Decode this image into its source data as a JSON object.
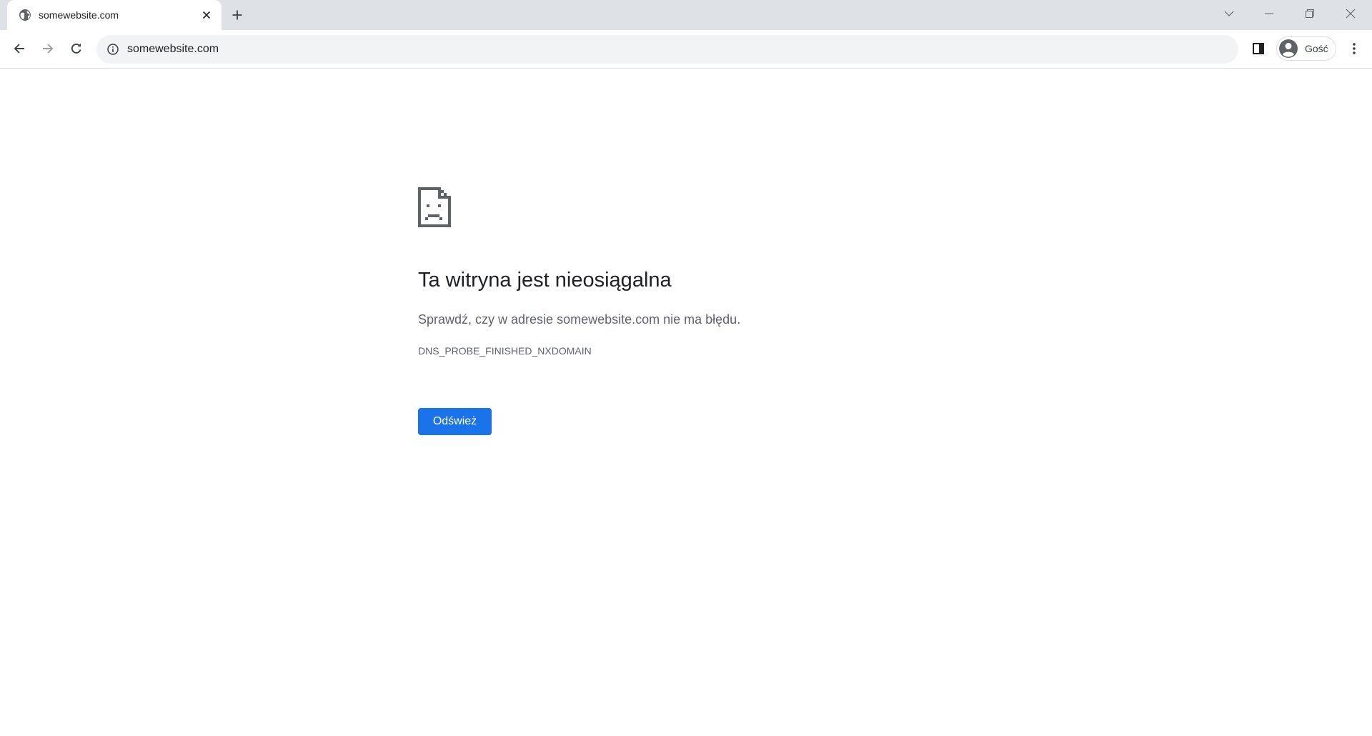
{
  "browser": {
    "tab": {
      "title": "somewebsite.com",
      "favicon": "globe-icon"
    },
    "window_controls": [
      "tab-search-icon",
      "minimize-icon",
      "restore-icon",
      "close-icon"
    ],
    "toolbar": {
      "back_icon": "arrow-left-icon",
      "forward_icon": "arrow-right-icon",
      "reload_icon": "reload-icon",
      "info_icon": "info-icon",
      "url": "somewebsite.com",
      "side_panel_icon": "side-panel-icon",
      "profile_label": "Gość",
      "profile_icon": "person-icon",
      "menu_icon": "kebab-menu-icon"
    }
  },
  "error_page": {
    "icon": "sad-document-icon",
    "title": "Ta witryna jest nieosiągalna",
    "description": "Sprawdź, czy w adresie somewebsite.com nie ma błędu.",
    "error_code": "DNS_PROBE_FINISHED_NXDOMAIN",
    "reload_button": "Odśwież"
  },
  "colors": {
    "tabstrip": "#dee1e6",
    "omnibox": "#f1f3f4",
    "accent": "#1a73e8",
    "title_text": "#202124",
    "secondary_text": "#5f6368"
  }
}
